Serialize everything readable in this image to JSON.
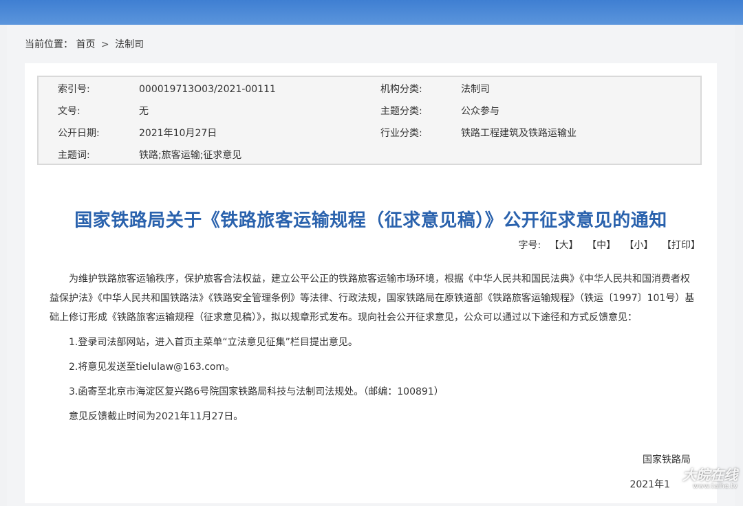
{
  "breadcrumb": {
    "prefix": "当前位置：",
    "home": "首页",
    "separator": ">",
    "current": "法制司"
  },
  "meta": {
    "rows": [
      {
        "label_left": "索引号:",
        "value_left": "000019713O03/2021-00111",
        "label_right": "机构分类:",
        "value_right": "法制司"
      },
      {
        "label_left": "文号:",
        "value_left": "无",
        "label_right": "主题分类:",
        "value_right": "公众参与"
      },
      {
        "label_left": "公开日期:",
        "value_left": "2021年10月27日",
        "label_right": "行业分类:",
        "value_right": "铁路工程建筑及铁路运输业"
      },
      {
        "label_left": "主题词:",
        "value_left": "铁路;旅客运输;征求意见",
        "label_right": "",
        "value_right": ""
      }
    ]
  },
  "title": "国家铁路局关于《铁路旅客运输规程（征求意见稿）》公开征求意见的通知",
  "font_size": {
    "label": "字号:",
    "large": "【大】",
    "medium": "【中】",
    "small": "【小】",
    "print": "【打印】"
  },
  "body": {
    "intro": "为维护铁路旅客运输秩序，保护旅客合法权益，建立公平公正的铁路旅客运输市场环境，根据《中华人民共和国民法典》《中华人民共和国消费者权益保护法》《中华人民共和国铁路法》《铁路安全管理条例》等法律、行政法规，国家铁路局在原铁道部《铁路旅客运输规程》（铁运〔1997〕101号）基础上修订形成《铁路旅客运输规程（征求意见稿）》，拟以规章形式发布。现向社会公开征求意见，公众可以通过以下途径和方式反馈意见：",
    "item1": "1.登录司法部网站，进入首页主菜单“立法意见征集”栏目提出意见。",
    "item2": "2.将意见发送至tielulaw@163.com。",
    "item3": "3.函寄至北京市海淀区复兴路6号院国家铁路局科技与法制司法规处。（邮编：100891）",
    "deadline": "意见反馈截止时间为2021年11月27日。"
  },
  "signature": "国家铁路局",
  "sign_date": "2021年1",
  "watermark": {
    "main": "大皖在线",
    "sub": "www.taihe.tv"
  },
  "colors": {
    "title": "#2a62ad",
    "top_band": "#4a88d8"
  }
}
